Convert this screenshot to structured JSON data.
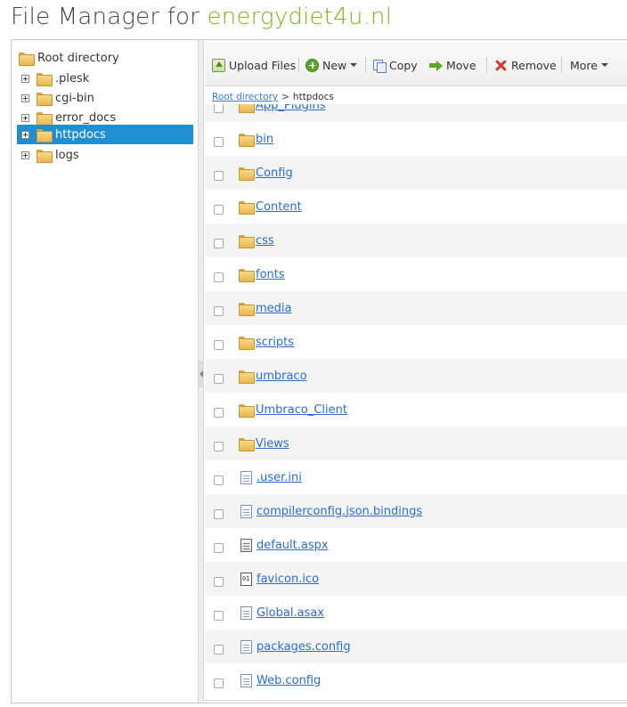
{
  "page": {
    "title_prefix": "File Manager for ",
    "title_domain": "energydiet4u.nl"
  },
  "tree": {
    "root_label": "Root directory",
    "items": [
      {
        "label": ".plesk",
        "selected": false
      },
      {
        "label": "cgi-bin",
        "selected": false
      },
      {
        "label": "error_docs",
        "selected": false
      },
      {
        "label": "httpdocs",
        "selected": true
      },
      {
        "label": "logs",
        "selected": false
      }
    ]
  },
  "toolbar": {
    "upload_label": "Upload Files",
    "new_label": "New",
    "copy_label": "Copy",
    "move_label": "Move",
    "remove_label": "Remove",
    "more_label": "More"
  },
  "breadcrumb": {
    "root_link": "Root directory",
    "separator": ">",
    "current": "httpdocs"
  },
  "files": [
    {
      "name": "App_Plugins",
      "type": "folder"
    },
    {
      "name": "bin",
      "type": "folder"
    },
    {
      "name": "Config",
      "type": "folder"
    },
    {
      "name": "Content",
      "type": "folder"
    },
    {
      "name": "css",
      "type": "folder"
    },
    {
      "name": "fonts",
      "type": "folder"
    },
    {
      "name": "media",
      "type": "folder"
    },
    {
      "name": "scripts",
      "type": "folder"
    },
    {
      "name": "umbraco",
      "type": "folder"
    },
    {
      "name": "Umbraco_Client",
      "type": "folder"
    },
    {
      "name": "Views",
      "type": "folder"
    },
    {
      "name": ".user.ini",
      "type": "file"
    },
    {
      "name": "compilerconfig.json.bindings",
      "type": "file"
    },
    {
      "name": "default.aspx",
      "type": "aspx"
    },
    {
      "name": "favicon.ico",
      "type": "ico"
    },
    {
      "name": "Global.asax",
      "type": "file"
    },
    {
      "name": "packages.config",
      "type": "file"
    },
    {
      "name": "Web.config",
      "type": "file"
    }
  ],
  "colors": {
    "accent_green": "#7cb51f",
    "selection_blue": "#1f8fd1",
    "link_blue": "#2a6ccf"
  }
}
